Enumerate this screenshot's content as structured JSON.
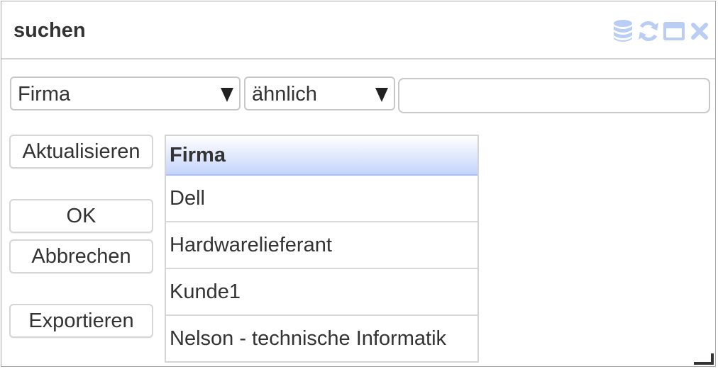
{
  "dialog": {
    "title": "suchen",
    "icons": [
      "database-icon",
      "refresh-icon",
      "window-icon",
      "close-icon"
    ],
    "accent_color": "#b9cdf5"
  },
  "filter": {
    "field_select": "Firma",
    "operator_select": "ähnlich",
    "search_value": ""
  },
  "buttons": {
    "refresh": "Aktualisieren",
    "ok": "OK",
    "cancel": "Abbrechen",
    "export": "Exportieren"
  },
  "grid": {
    "header": "Firma",
    "rows": [
      "Dell",
      "Hardwarelieferant",
      "Kunde1",
      "Nelson - technische Informatik"
    ]
  }
}
